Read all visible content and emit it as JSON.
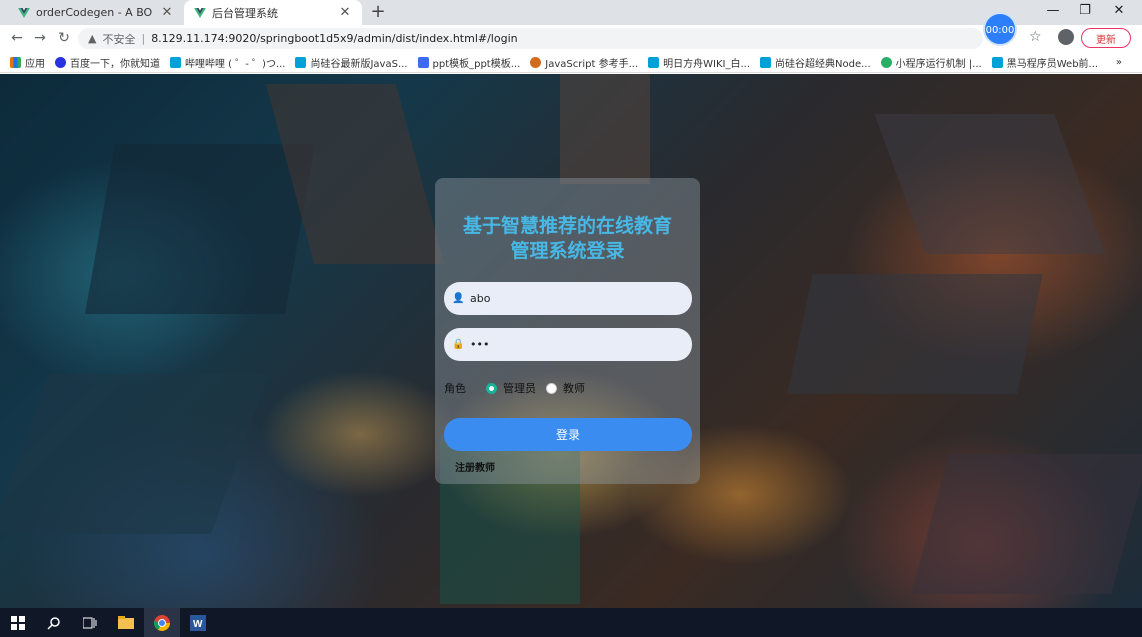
{
  "browser": {
    "tabs": [
      {
        "title": "orderCodegen - A BO",
        "icon": "vue-logo-icon"
      },
      {
        "title": "后台管理系统",
        "icon": "vue-logo-icon"
      }
    ],
    "new_tab": "+",
    "window_controls": {
      "minimize": "—",
      "maximize": "❐",
      "close": "✕"
    },
    "address": {
      "security_label": "不安全",
      "url": "8.129.11.174:9020/springboot1d5x9/admin/dist/index.html#/login"
    },
    "timer": "00:00",
    "update_label": "更新",
    "bookmarks": [
      {
        "label": "应用",
        "color": "#e8710a"
      },
      {
        "label": "百度一下，你就知道",
        "color": "#2932e1"
      },
      {
        "label": "哔哩哔哩 ( ゜- ゜)つ...",
        "color": "#00a1d6"
      },
      {
        "label": "尚硅谷最新版JavaS...",
        "color": "#00a1d6"
      },
      {
        "label": "ppt模板_ppt模板...",
        "color": "#3b6cf0"
      },
      {
        "label": "JavaScript 参考手...",
        "color": "#d36b1f"
      },
      {
        "label": "明日方舟WIKI_白...",
        "color": "#00a1d6"
      },
      {
        "label": "尚硅谷超经典Node...",
        "color": "#00a1d6"
      },
      {
        "label": "小程序运行机制 |...",
        "color": "#2aae67"
      },
      {
        "label": "黑马程序员Web前...",
        "color": "#00a1d6"
      }
    ],
    "bookmarks_more": "»"
  },
  "login": {
    "title_line1": "基于智慧推荐的在线教育",
    "title_line2": "管理系统登录",
    "username_value": "abo",
    "password_value": "•••",
    "role_label": "角色",
    "roles": [
      {
        "label": "管理员",
        "selected": true
      },
      {
        "label": "教师",
        "selected": false
      }
    ],
    "login_button": "登录",
    "register_link": "注册教师"
  },
  "taskbar": {
    "items": [
      "windows-start-icon",
      "search-icon",
      "task-view-icon",
      "file-explorer-icon",
      "chrome-icon",
      "word-icon"
    ],
    "active_index": 4
  },
  "colors": {
    "title": "#47b8e6",
    "login_button": "#3a8cf0",
    "radio_selected": "#19b39a",
    "update": "#dd3333",
    "timer": "#2d7ff9"
  }
}
